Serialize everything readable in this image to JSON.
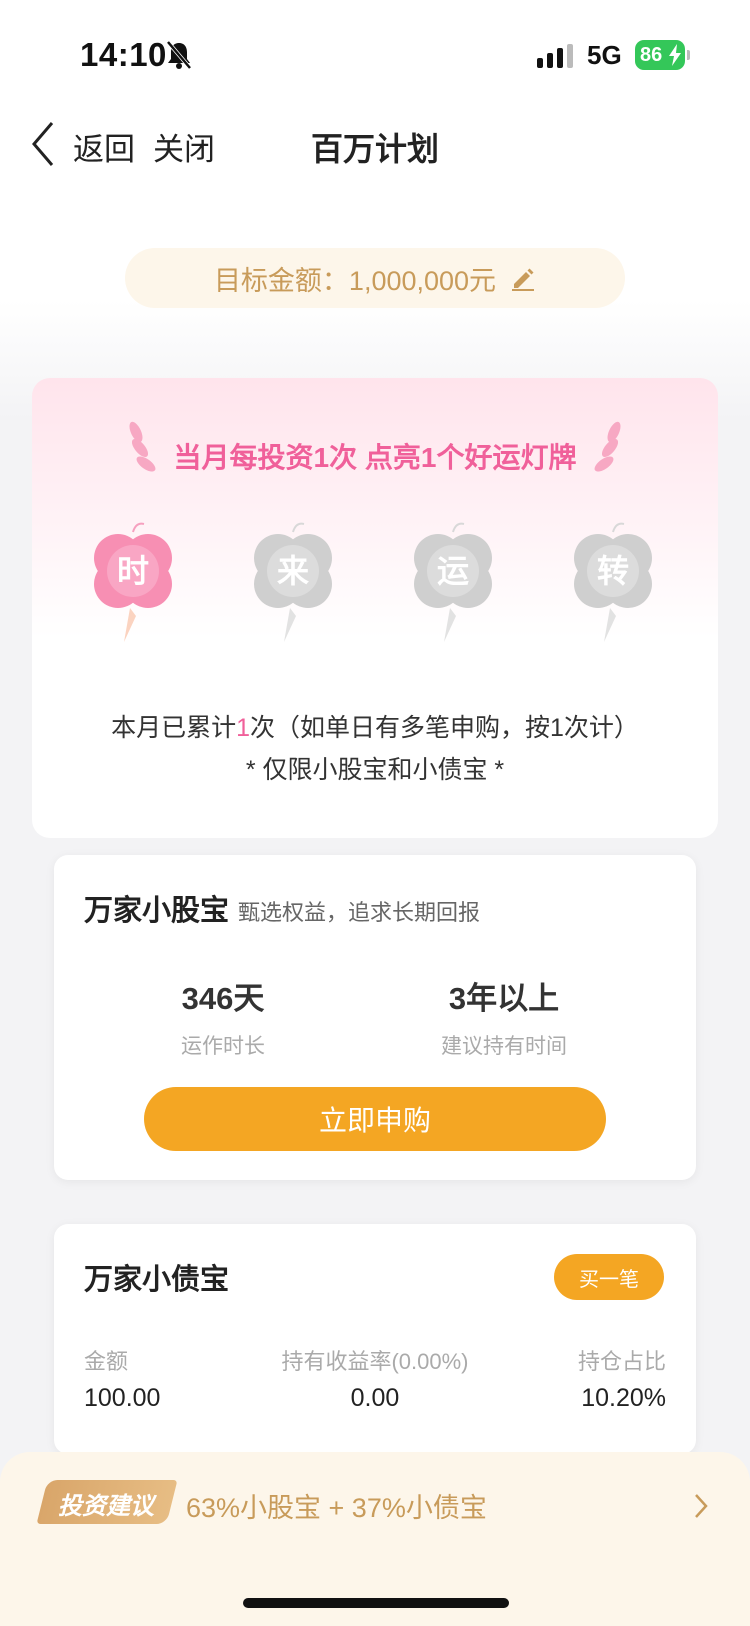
{
  "status_bar": {
    "time": "14:10",
    "network": "5G",
    "battery": "86"
  },
  "nav": {
    "back_label": "返回",
    "close_label": "关闭",
    "title": "百万计划"
  },
  "target": {
    "text": "目标金额：1,000,000元"
  },
  "lucky": {
    "title": "当月每投资1次 点亮1个好运灯牌",
    "clovers": [
      {
        "char": "时",
        "lit": true
      },
      {
        "char": "来",
        "lit": false
      },
      {
        "char": "运",
        "lit": false
      },
      {
        "char": "转",
        "lit": false
      }
    ],
    "count_prefix": "本月已累计",
    "count_value": "1",
    "count_suffix": "次（如单日有多笔申购，按1次计）",
    "limit_note": "* 仅限小股宝和小债宝 *"
  },
  "stock_fund": {
    "name": "万家小股宝",
    "subtitle": "甄选权益，追求长期回报",
    "stat1_value": "346天",
    "stat1_label": "运作时长",
    "stat2_value": "3年以上",
    "stat2_label": "建议持有时间",
    "button_label": "立即申购"
  },
  "bond_fund": {
    "name": "万家小债宝",
    "button_label": "买一笔",
    "amount_label": "金额",
    "amount_value": "100.00",
    "yield_label": "持有收益率(0.00%)",
    "yield_value": "0.00",
    "ratio_label": "持仓占比",
    "ratio_value": "10.20%"
  },
  "advice": {
    "tag": "投资建议",
    "text": "63%小股宝 + 37%小债宝"
  },
  "colors": {
    "accent_orange": "#f4a623",
    "accent_pink": "#f0609a",
    "gold_text": "#c89b5a"
  }
}
